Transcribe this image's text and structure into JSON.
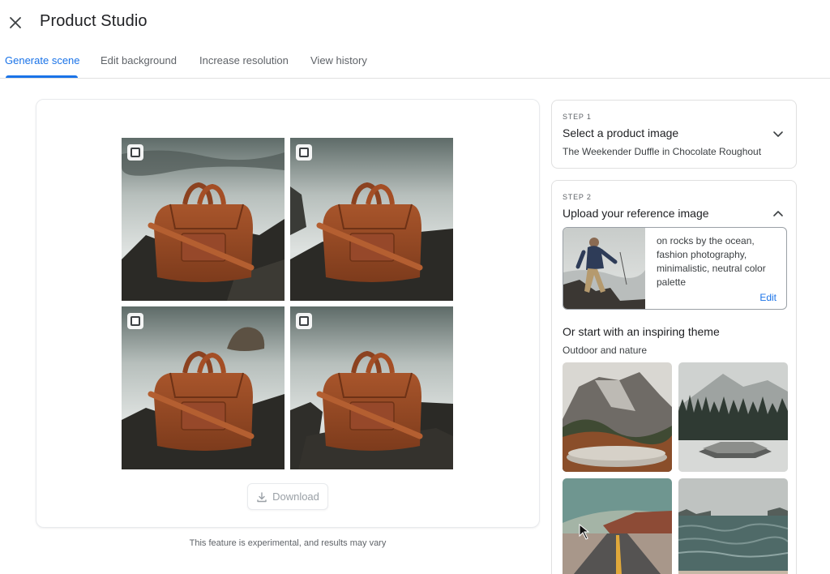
{
  "header": {
    "title": "Product Studio"
  },
  "tabs": [
    {
      "label": "Generate scene",
      "active": true
    },
    {
      "label": "Edit background",
      "active": false
    },
    {
      "label": "Increase resolution",
      "active": false
    },
    {
      "label": "View history",
      "active": false
    }
  ],
  "results": {
    "download_label": "Download",
    "disclaimer": "This feature is experimental, and results may vary"
  },
  "step1": {
    "label": "STEP 1",
    "title": "Select a product image",
    "selected_product": "The Weekender Duffle in Chocolate Roughout"
  },
  "step2": {
    "label": "STEP 2",
    "title": "Upload your reference image",
    "prompt": "on rocks by the ocean, fashion photography, minimalistic, neutral color palette",
    "edit_label": "Edit",
    "theme_heading": "Or start with an inspiring theme",
    "theme_category": "Outdoor and nature"
  },
  "colors": {
    "accent": "#1a73e8",
    "bag": "#9a4a25",
    "text": "#202124"
  }
}
